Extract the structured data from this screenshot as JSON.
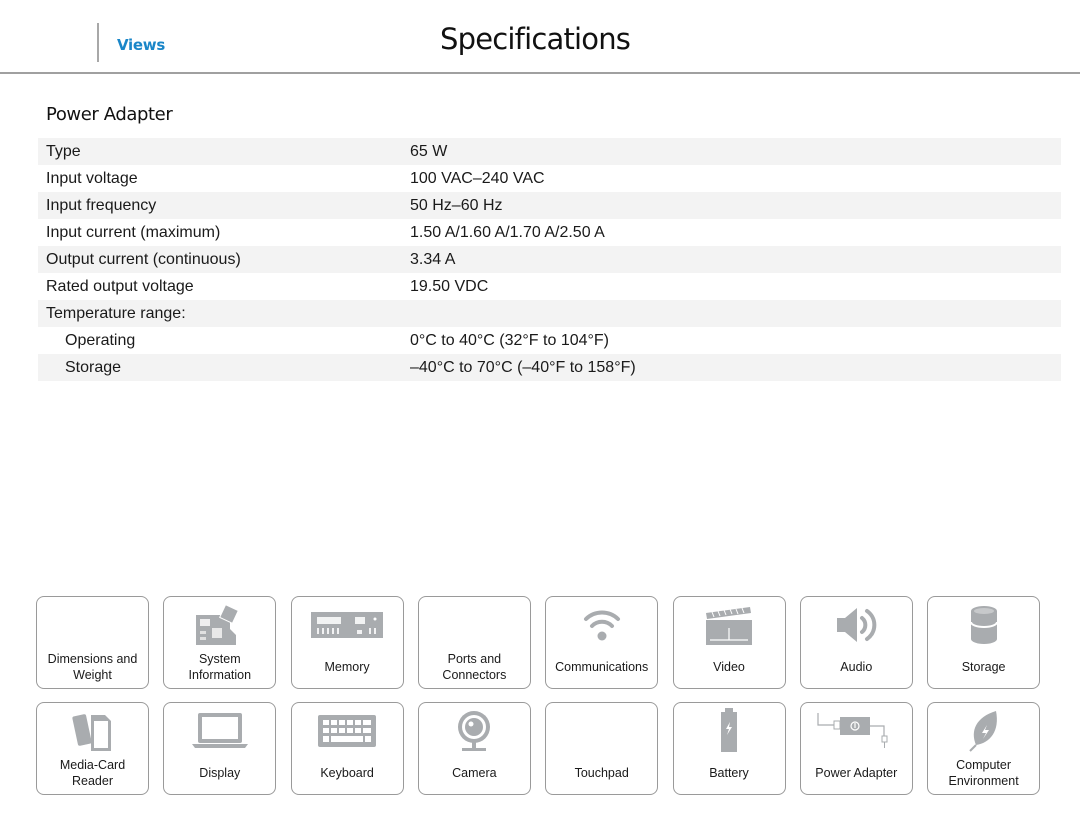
{
  "header": {
    "nav_link": "Views",
    "title": "Specifications"
  },
  "section": {
    "title": "Power Adapter",
    "rows": [
      {
        "label": "Type",
        "value": "65 W",
        "indent": false
      },
      {
        "label": "Input voltage",
        "value": "100 VAC–240 VAC",
        "indent": false
      },
      {
        "label": "Input frequency",
        "value": "50 Hz–60 Hz",
        "indent": false
      },
      {
        "label": "Input current (maximum)",
        "value": "1.50 A/1.60 A/1.70 A/2.50 A",
        "indent": false
      },
      {
        "label": "Output current (continuous)",
        "value": "3.34 A",
        "indent": false
      },
      {
        "label": "Rated output voltage",
        "value": "19.50 VDC",
        "indent": false
      },
      {
        "label": "Temperature range:",
        "value": "",
        "indent": false
      },
      {
        "label": "Operating",
        "value": "0°C to 40°C (32°F to 104°F)",
        "indent": true
      },
      {
        "label": "Storage",
        "value": "–40°C to 70°C (–40°F to 158°F)",
        "indent": true
      }
    ]
  },
  "nav_tiles": [
    {
      "label": "Dimensions and\nWeight",
      "icon": "none"
    },
    {
      "label": "System\nInformation",
      "icon": "motherboard-icon"
    },
    {
      "label": "Memory",
      "icon": "memory-module-icon"
    },
    {
      "label": "Ports and\nConnectors",
      "icon": "none"
    },
    {
      "label": "Communications",
      "icon": "wifi-icon"
    },
    {
      "label": "Video",
      "icon": "clapperboard-icon"
    },
    {
      "label": "Audio",
      "icon": "speaker-icon"
    },
    {
      "label": "Storage",
      "icon": "drive-cylinder-icon"
    },
    {
      "label": "Media-Card\nReader",
      "icon": "media-card-icon"
    },
    {
      "label": "Display",
      "icon": "laptop-display-icon"
    },
    {
      "label": "Keyboard",
      "icon": "keyboard-icon"
    },
    {
      "label": "Camera",
      "icon": "webcam-icon"
    },
    {
      "label": "Touchpad",
      "icon": "none"
    },
    {
      "label": "Battery",
      "icon": "battery-icon"
    },
    {
      "label": "Power Adapter",
      "icon": "power-adapter-icon"
    },
    {
      "label": "Computer\nEnvironment",
      "icon": "leaf-icon"
    }
  ],
  "colors": {
    "accent": "#1a86c8",
    "icon_gray": "#a9acaf",
    "row_stripe": "#f3f3f3"
  }
}
